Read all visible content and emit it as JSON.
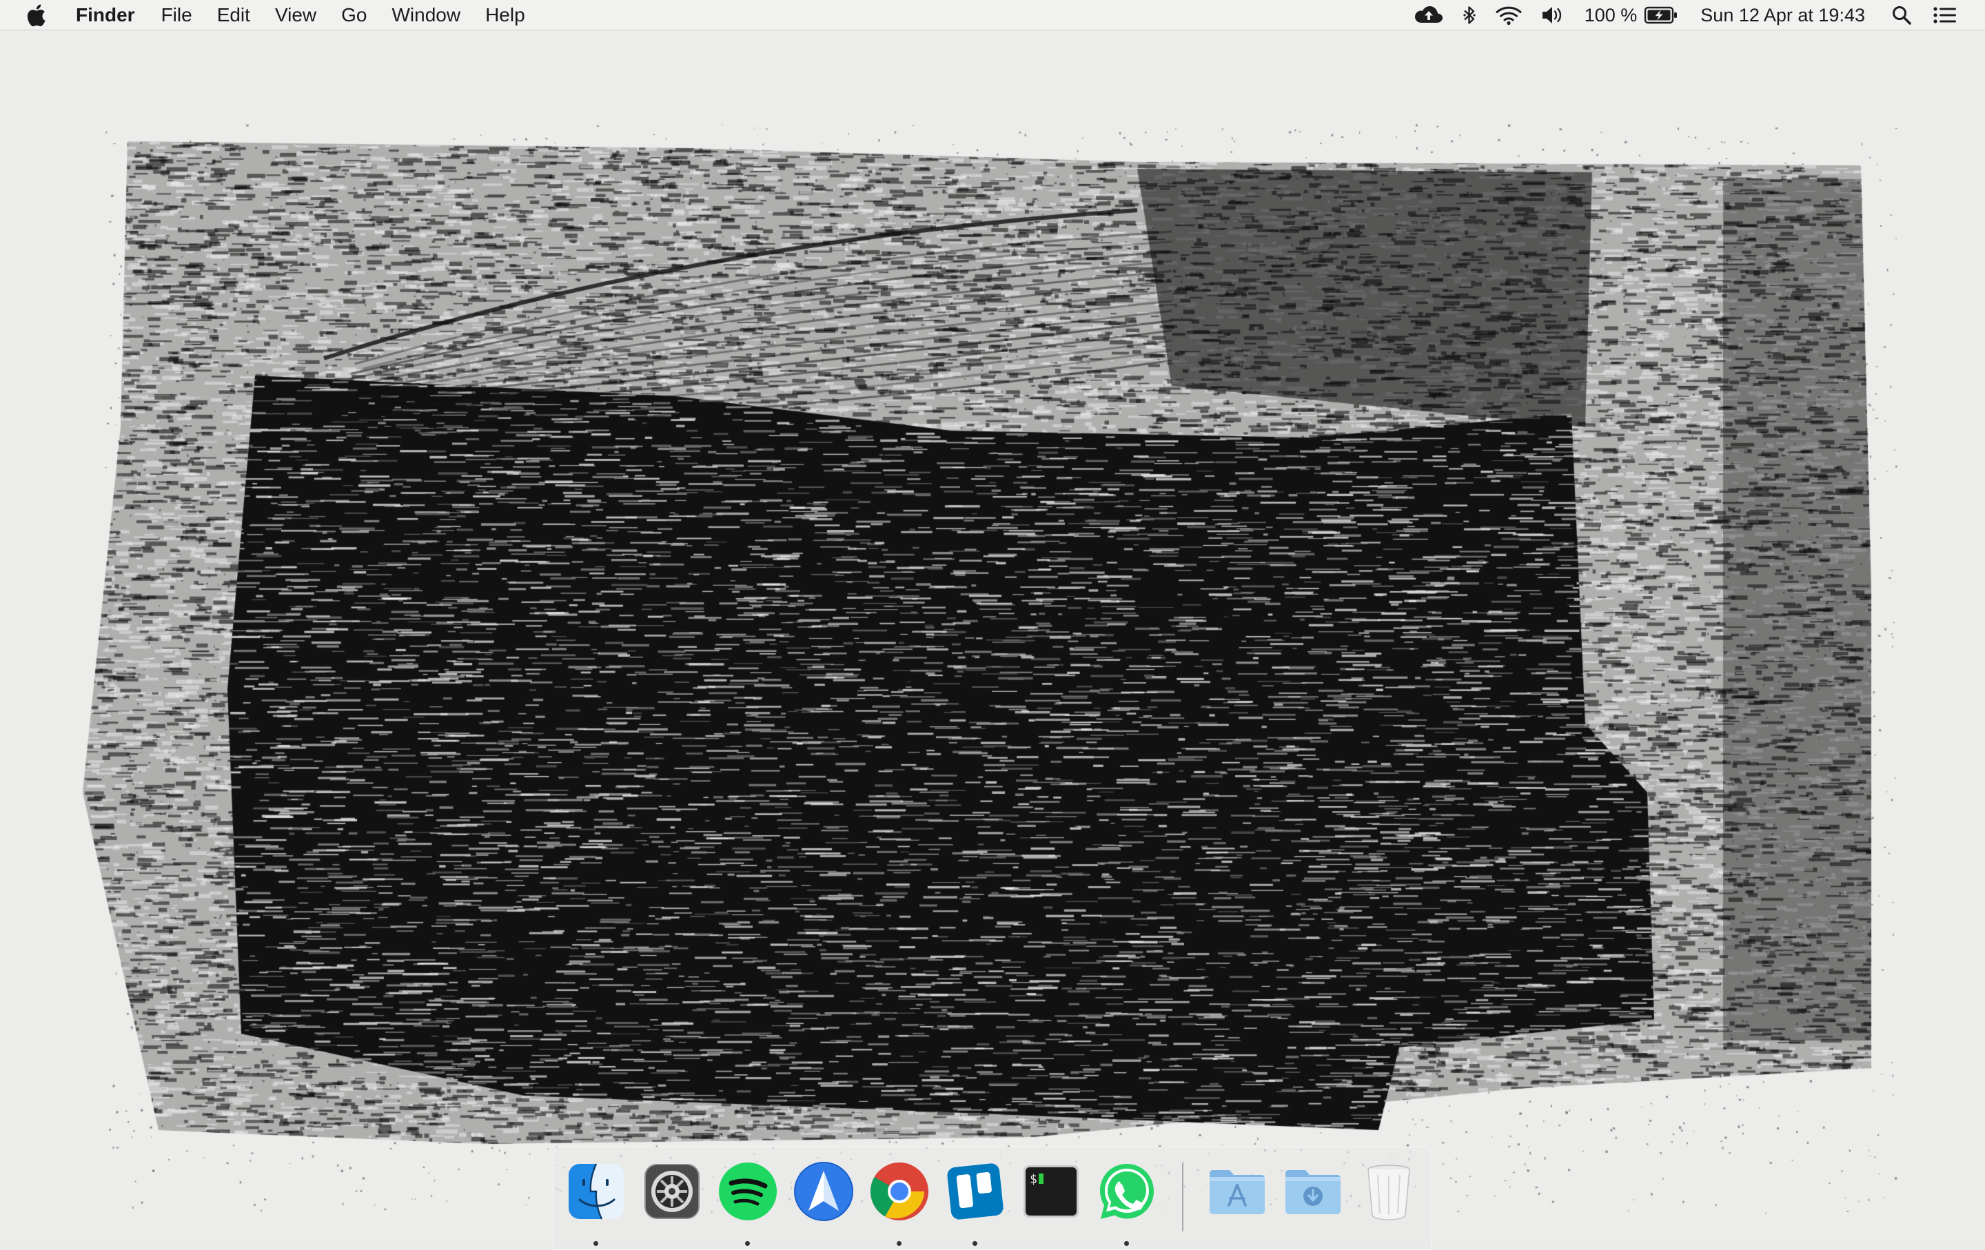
{
  "menubar": {
    "app_name": "Finder",
    "menus": [
      "File",
      "Edit",
      "View",
      "Go",
      "Window",
      "Help"
    ],
    "status_icons": [
      "cloud-upload-icon",
      "bluetooth-icon",
      "wifi-icon",
      "volume-icon"
    ],
    "battery_percent": "100 %",
    "clock": "Sun 12 Apr at  19:43"
  },
  "dock": {
    "apps": [
      {
        "name": "Finder",
        "icon": "finder-icon",
        "running": true
      },
      {
        "name": "System Preferences",
        "icon": "system-preferences-icon",
        "running": false
      },
      {
        "name": "Spotify",
        "icon": "spotify-icon",
        "running": true
      },
      {
        "name": "Spark",
        "icon": "spark-mail-icon",
        "running": false
      },
      {
        "name": "Google Chrome",
        "icon": "chrome-icon",
        "running": true
      },
      {
        "name": "Trello",
        "icon": "trello-icon",
        "running": true
      },
      {
        "name": "Terminal",
        "icon": "terminal-icon",
        "running": false
      },
      {
        "name": "WhatsApp",
        "icon": "whatsapp-icon",
        "running": true
      }
    ],
    "folders": [
      {
        "name": "Applications",
        "icon": "applications-folder-icon"
      },
      {
        "name": "Downloads",
        "icon": "downloads-folder-icon"
      },
      {
        "name": "Trash",
        "icon": "trash-icon"
      }
    ]
  },
  "colors": {
    "wallpaper_paper": "#ececeb",
    "wallpaper_ink": "#111111",
    "menubar": "#f1f1f0",
    "spotify": "#1ed760",
    "whatsapp": "#25d366",
    "trello": "#0079bf",
    "folder": "#8ec3ec"
  }
}
